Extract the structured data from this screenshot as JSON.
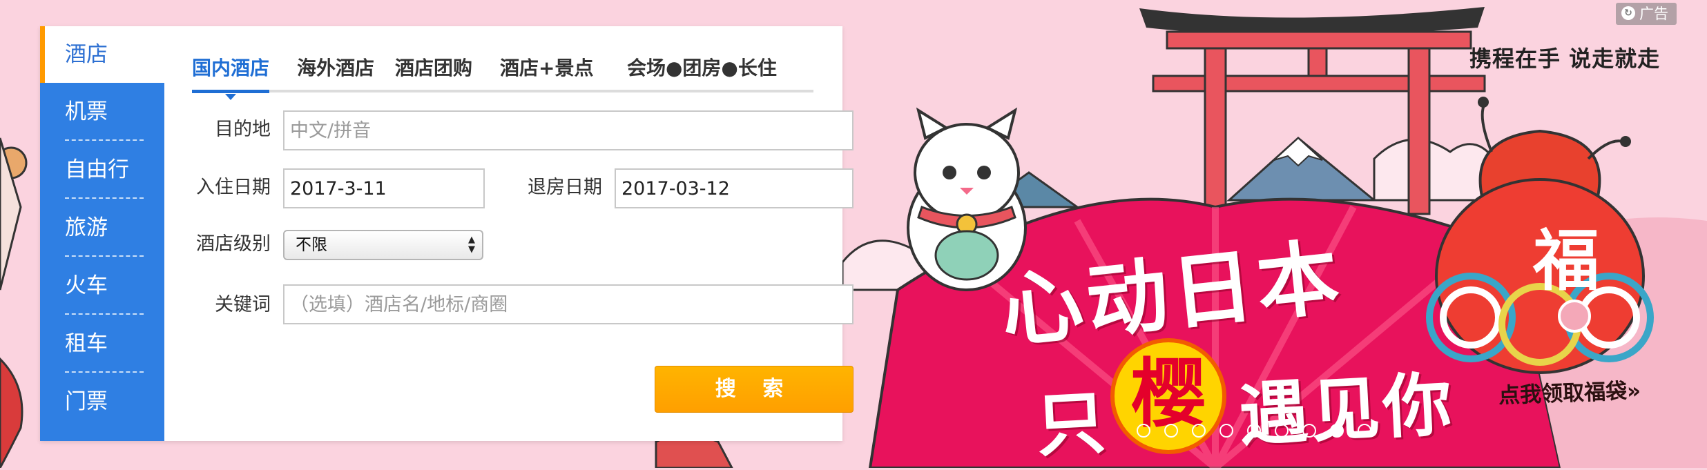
{
  "sidebar": {
    "items": [
      {
        "label": "酒店",
        "active": true
      },
      {
        "label": "机票"
      },
      {
        "label": "自由行"
      },
      {
        "label": "旅游"
      },
      {
        "label": "火车"
      },
      {
        "label": "租车"
      },
      {
        "label": "门票"
      }
    ]
  },
  "tabs": [
    {
      "label": "国内酒店",
      "active": true
    },
    {
      "label": "海外酒店"
    },
    {
      "label": "酒店团购"
    },
    {
      "label": "酒店+景点"
    },
    {
      "label": "会场●团房●长住"
    }
  ],
  "form": {
    "destination": {
      "label": "目的地",
      "placeholder": "中文/拼音"
    },
    "checkin": {
      "label": "入住日期",
      "value": "2017-3-11"
    },
    "checkout": {
      "label": "退房日期",
      "value": "2017-03-12"
    },
    "star": {
      "label": "酒店级别",
      "value": "不限"
    },
    "keyword": {
      "label": "关键词",
      "placeholder": "（选填）酒店名/地标/商圈"
    },
    "search_label": "搜 索"
  },
  "banner": {
    "ad_label": "广告",
    "slogan": "携程在手  说走就走",
    "headline_1": "心动日本",
    "headline_2a": "只",
    "headline_2b": "樱",
    "headline_2c": "遇见你",
    "fu": "福",
    "cta": "点我领取福袋»",
    "slide_count": 9,
    "active_slide": 7
  },
  "colors": {
    "sidebar_bg": "#2f7fe3",
    "active_tab": "#1f6ed4",
    "search_button": "#ffa800",
    "banner_pink": "#fbd3df",
    "banner_magenta": "#e8125c"
  }
}
